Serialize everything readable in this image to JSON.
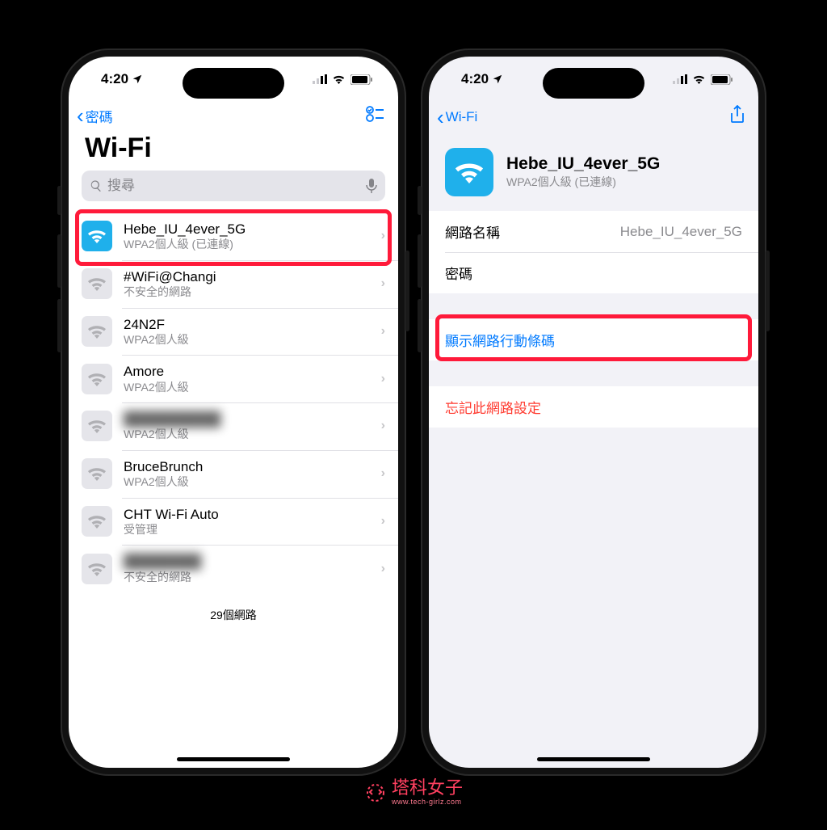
{
  "status": {
    "time": "4:20",
    "signal": "•ıl",
    "wifi": "wifi",
    "battery": "battery"
  },
  "left": {
    "back_label": "密碼",
    "title": "Wi-Fi",
    "search_placeholder": "搜尋",
    "footer": "29個網路",
    "networks": [
      {
        "name": "Hebe_IU_4ever_5G",
        "sub": "WPA2個人級 (已連線)",
        "active": true
      },
      {
        "name": "#WiFi@Changi",
        "sub": "不安全的網路",
        "active": false
      },
      {
        "name": "24N2F",
        "sub": "WPA2個人級",
        "active": false
      },
      {
        "name": "Amore",
        "sub": "WPA2個人級",
        "active": false
      },
      {
        "name": "██████████",
        "sub": "WPA2個人級",
        "active": false,
        "blurred": true
      },
      {
        "name": "BruceBrunch",
        "sub": "WPA2個人級",
        "active": false
      },
      {
        "name": "CHT Wi-Fi Auto",
        "sub": "受管理",
        "active": false
      },
      {
        "name": "████████",
        "sub": "不安全的網路",
        "active": false,
        "blurred": true
      }
    ]
  },
  "right": {
    "back_label": "Wi-Fi",
    "network_name": "Hebe_IU_4ever_5G",
    "network_sub": "WPA2個人級 (已連線)",
    "field_name_label": "網路名稱",
    "field_name_value": "Hebe_IU_4ever_5G",
    "field_password_label": "密碼",
    "show_qr": "顯示網路行動條碼",
    "forget": "忘記此網路設定"
  },
  "watermark": {
    "main": "塔科女子",
    "sub": "www.tech-girlz.com"
  },
  "colors": {
    "ios_blue": "#007aff",
    "ios_red": "#ff3b30",
    "wifi_badge": "#1fb0eb",
    "highlight": "#ff1a3a"
  }
}
